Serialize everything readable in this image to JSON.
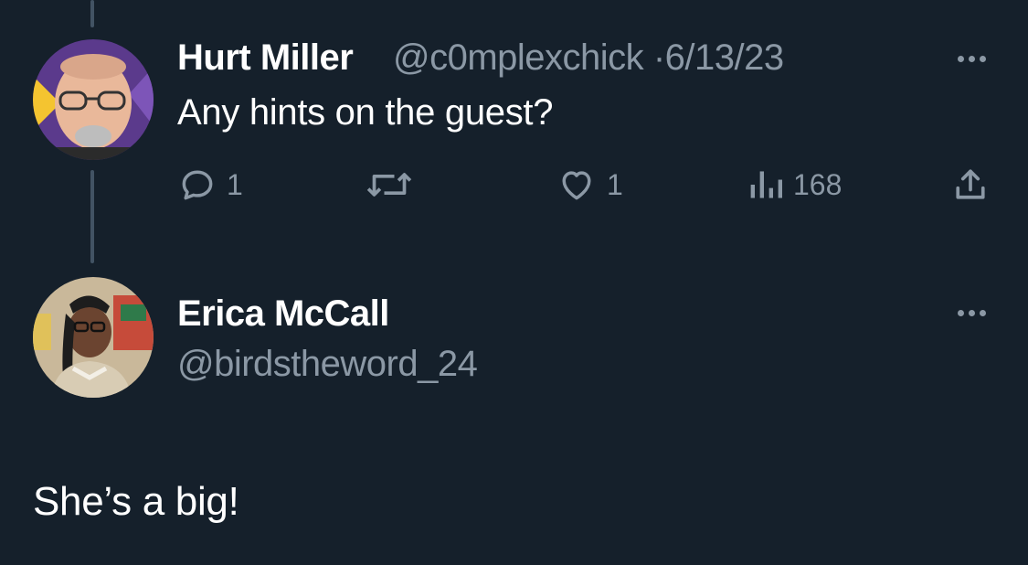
{
  "reply_parent": {
    "author_name": "Hurt Miller",
    "handle": "@c0mplexchick",
    "separator": "·",
    "date": "6/13/23",
    "text": "Any hints on the guest?",
    "actions": {
      "reply_count": "1",
      "retweet_count": "",
      "like_count": "1",
      "views_count": "168"
    }
  },
  "reply": {
    "author_name": "Erica McCall",
    "handle": "@birdstheword_24",
    "text": "She’s a big!"
  },
  "colors": {
    "background": "#15202b",
    "primary_text": "#ffffff",
    "secondary_text": "#8b98a5",
    "thread_line": "#425364"
  }
}
